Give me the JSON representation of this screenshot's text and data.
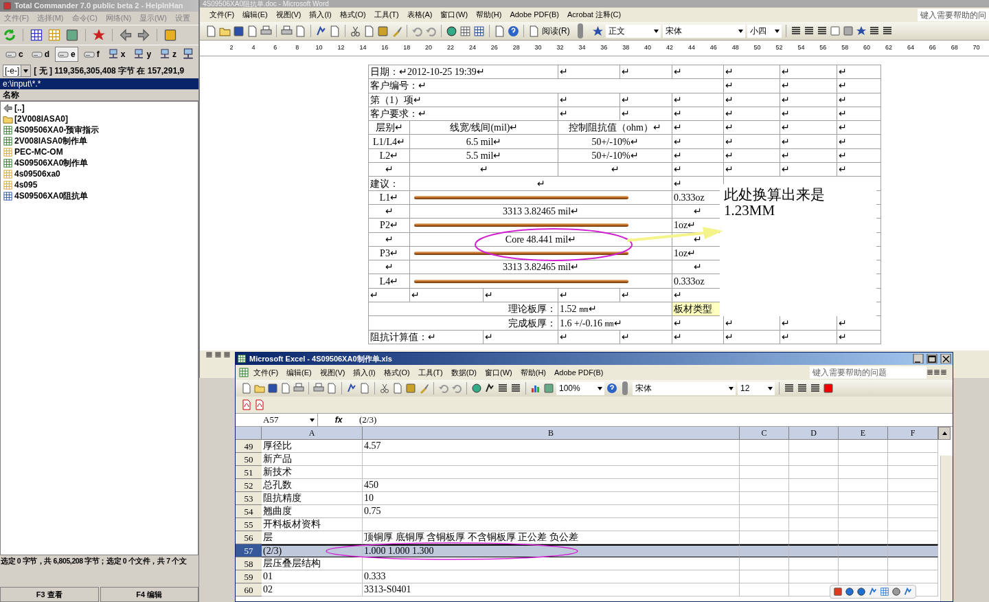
{
  "total_commander": {
    "title": "Total Commander 7.0 public beta 2 - HelpInHan",
    "menu": [
      "文件(F)",
      "选择(M)",
      "命令(C)",
      "网络(N)",
      "显示(W)",
      "设置"
    ],
    "drives": [
      {
        "label": "c",
        "kind": "local",
        "selected": false
      },
      {
        "label": "d",
        "kind": "local",
        "selected": false
      },
      {
        "label": "e",
        "kind": "local",
        "selected": true
      },
      {
        "label": "f",
        "kind": "local",
        "selected": false
      },
      {
        "label": "x",
        "kind": "network",
        "selected": false
      },
      {
        "label": "y",
        "kind": "network",
        "selected": false
      },
      {
        "label": "z",
        "kind": "network",
        "selected": false
      }
    ],
    "drive_select": "[-e-]",
    "free_space": "[ 无 ]  119,356,305,408 字节 在 157,291,9",
    "path": "e:\\input\\*.*",
    "column_header": "名称",
    "files": [
      {
        "name": "[..]",
        "kind": "up"
      },
      {
        "name": "[2V008IASA0]",
        "kind": "folder"
      },
      {
        "name": "4S09506XA0-预审指示",
        "kind": "excel"
      },
      {
        "name": "2V008IASA0制作单",
        "kind": "excel"
      },
      {
        "name": "PEC-MC-OM",
        "kind": "archive"
      },
      {
        "name": "4S09506XA0制作单",
        "kind": "excel"
      },
      {
        "name": "4s09506xa0",
        "kind": "archive"
      },
      {
        "name": "4s095",
        "kind": "archive"
      },
      {
        "name": "4S09506XA0阻抗单",
        "kind": "word"
      }
    ],
    "status": "选定 0 字节，共 6,805,208 字节；选定 0 个文件，共 7 个文",
    "function_keys": [
      "F3 查看",
      "F4 编辑"
    ]
  },
  "word": {
    "title": "4S09506XA0阻抗单.doc - Microsoft Word",
    "menu": [
      "文件(F)",
      "编辑(E)",
      "视图(V)",
      "插入(I)",
      "格式(O)",
      "工具(T)",
      "表格(A)",
      "窗口(W)",
      "帮助(H)",
      "Adobe PDF(B)",
      "Acrobat 注释(C)"
    ],
    "help_box": "键入需要帮助的问",
    "read_button": "阅读(R)",
    "style": "正文",
    "font": "宋体",
    "font_size": "小四",
    "ruler": [
      "2",
      "4",
      "6",
      "8",
      "10",
      "12",
      "14",
      "16",
      "18",
      "20",
      "22",
      "24",
      "26",
      "28",
      "30",
      "32",
      "34",
      "36",
      "38",
      "40",
      "42",
      "44",
      "46",
      "48",
      "50",
      "52",
      "54",
      "56",
      "58",
      "60",
      "62",
      "64",
      "66",
      "68",
      "70"
    ],
    "table": [
      {
        "kind": "info",
        "cells": [
          "日期：↵2012-10-25 19:39↵",
          "↵",
          "↵",
          "↵",
          "↵",
          "↵",
          "↵"
        ]
      },
      {
        "kind": "customer",
        "cells": [
          "客户编号：↵",
          "↵",
          "↵",
          "↵"
        ]
      },
      {
        "kind": "info",
        "cells": [
          "第（1）项↵",
          "↵",
          "↵",
          "↵",
          "↵",
          "↵",
          "↵"
        ]
      },
      {
        "kind": "info",
        "cells": [
          "客户要求：↵",
          "↵",
          "↵",
          "↵",
          "↵",
          "↵",
          "↵"
        ]
      },
      {
        "kind": "spec",
        "cells": [
          "层别↵",
          "线宽/线间(mil)↵",
          "控制阻抗值（ohm）↵",
          "↵",
          "↵",
          "↵",
          "↵"
        ]
      },
      {
        "kind": "spec",
        "cells": [
          "L1/L4↵",
          "6.5 mil↵",
          "50+/-10%↵",
          "↵",
          "↵",
          "↵",
          "↵"
        ]
      },
      {
        "kind": "spec",
        "cells": [
          "L2↵",
          "5.5 mil↵",
          "50+/-10%↵",
          "↵",
          "↵",
          "↵",
          "↵"
        ]
      },
      {
        "kind": "spec",
        "cells": [
          "↵",
          "↵",
          "↵",
          "↵",
          "↵",
          "↵",
          "↵"
        ]
      },
      {
        "kind": "advice",
        "cells": [
          "建议：",
          "↵",
          "↵"
        ]
      },
      {
        "kind": "layer",
        "cells": [
          "L1↵",
          "0.333oz"
        ]
      },
      {
        "kind": "stack",
        "cells": [
          "↵",
          "3313      3.82465 mil↵",
          "↵"
        ]
      },
      {
        "kind": "layer",
        "cells": [
          "P2↵",
          "1oz↵"
        ]
      },
      {
        "kind": "stack",
        "cells": [
          "↵",
          "Core    48.441 mil↵",
          "↵"
        ]
      },
      {
        "kind": "layer",
        "cells": [
          "P3↵",
          "1oz↵"
        ]
      },
      {
        "kind": "stack",
        "cells": [
          "↵",
          "3313      3.82465 mil↵",
          "↵"
        ]
      },
      {
        "kind": "layer",
        "cells": [
          "L4↵",
          "0.333oz"
        ]
      },
      {
        "kind": "marks",
        "cells": [
          "↵",
          "↵",
          "↵",
          "↵",
          "↵",
          "↵"
        ]
      },
      {
        "kind": "thickness",
        "cells": [
          "理论板厚：",
          "1.52 ㎜↵",
          "板材类型"
        ],
        "highlighted": true
      },
      {
        "kind": "thickness",
        "cells": [
          "完成板厚：",
          "1.6 +/-0.16 ㎜↵",
          "↵",
          "↵",
          "↵",
          "↵"
        ],
        "highlighted": false
      },
      {
        "kind": "calc",
        "cells": [
          "阻抗计算值：↵",
          "↵",
          "↵",
          "↵",
          "↵",
          "↵",
          "↵",
          "↵"
        ]
      }
    ],
    "callout": "此处换算出来是1.23MM"
  },
  "excel": {
    "title": "Microsoft Excel - 4S09506XA0制作单.xls",
    "menu": [
      "文件(F)",
      "编辑(E)",
      "视图(V)",
      "插入(I)",
      "格式(O)",
      "工具(T)",
      "数据(D)",
      "窗口(W)",
      "帮助(H)",
      "Adobe PDF(B)"
    ],
    "help_box": "键入需要帮助的问题",
    "zoom": "100%",
    "font": "宋体",
    "font_size": "12",
    "name_box": "A57",
    "fx": "fx",
    "formula": "(2/3)",
    "columns": [
      "A",
      "B",
      "C",
      "D",
      "E",
      "F"
    ],
    "rows": [
      {
        "number": "49",
        "a": "厚径比",
        "b": "4.57",
        "selected": false
      },
      {
        "number": "50",
        "a": "新产品",
        "selected": false
      },
      {
        "number": "51",
        "a": "新技术",
        "selected": false
      },
      {
        "number": "52",
        "a": "总孔数",
        "b": "450",
        "selected": false
      },
      {
        "number": "53",
        "a": "阻抗精度",
        "b": "10",
        "selected": false
      },
      {
        "number": "54",
        "a": "翘曲度",
        "b": "0.75",
        "selected": false
      },
      {
        "number": "55",
        "a": "开料板材资料",
        "selected": false
      },
      {
        "number": "56",
        "a": "层",
        "b": "顶铜厚 底铜厚 含铜板厚 不含铜板厚 正公差 负公差",
        "selected": false
      },
      {
        "number": "57",
        "a": "(2/3)",
        "b": "1.000  1.000   1.300",
        "selected": true
      },
      {
        "number": "58",
        "a": "层压叠层结构",
        "selected": false
      },
      {
        "number": "59",
        "a": "01",
        "b": "0.333",
        "selected": false
      },
      {
        "number": "60",
        "a": "02",
        "b": "3313-S0401",
        "selected": false
      }
    ]
  }
}
